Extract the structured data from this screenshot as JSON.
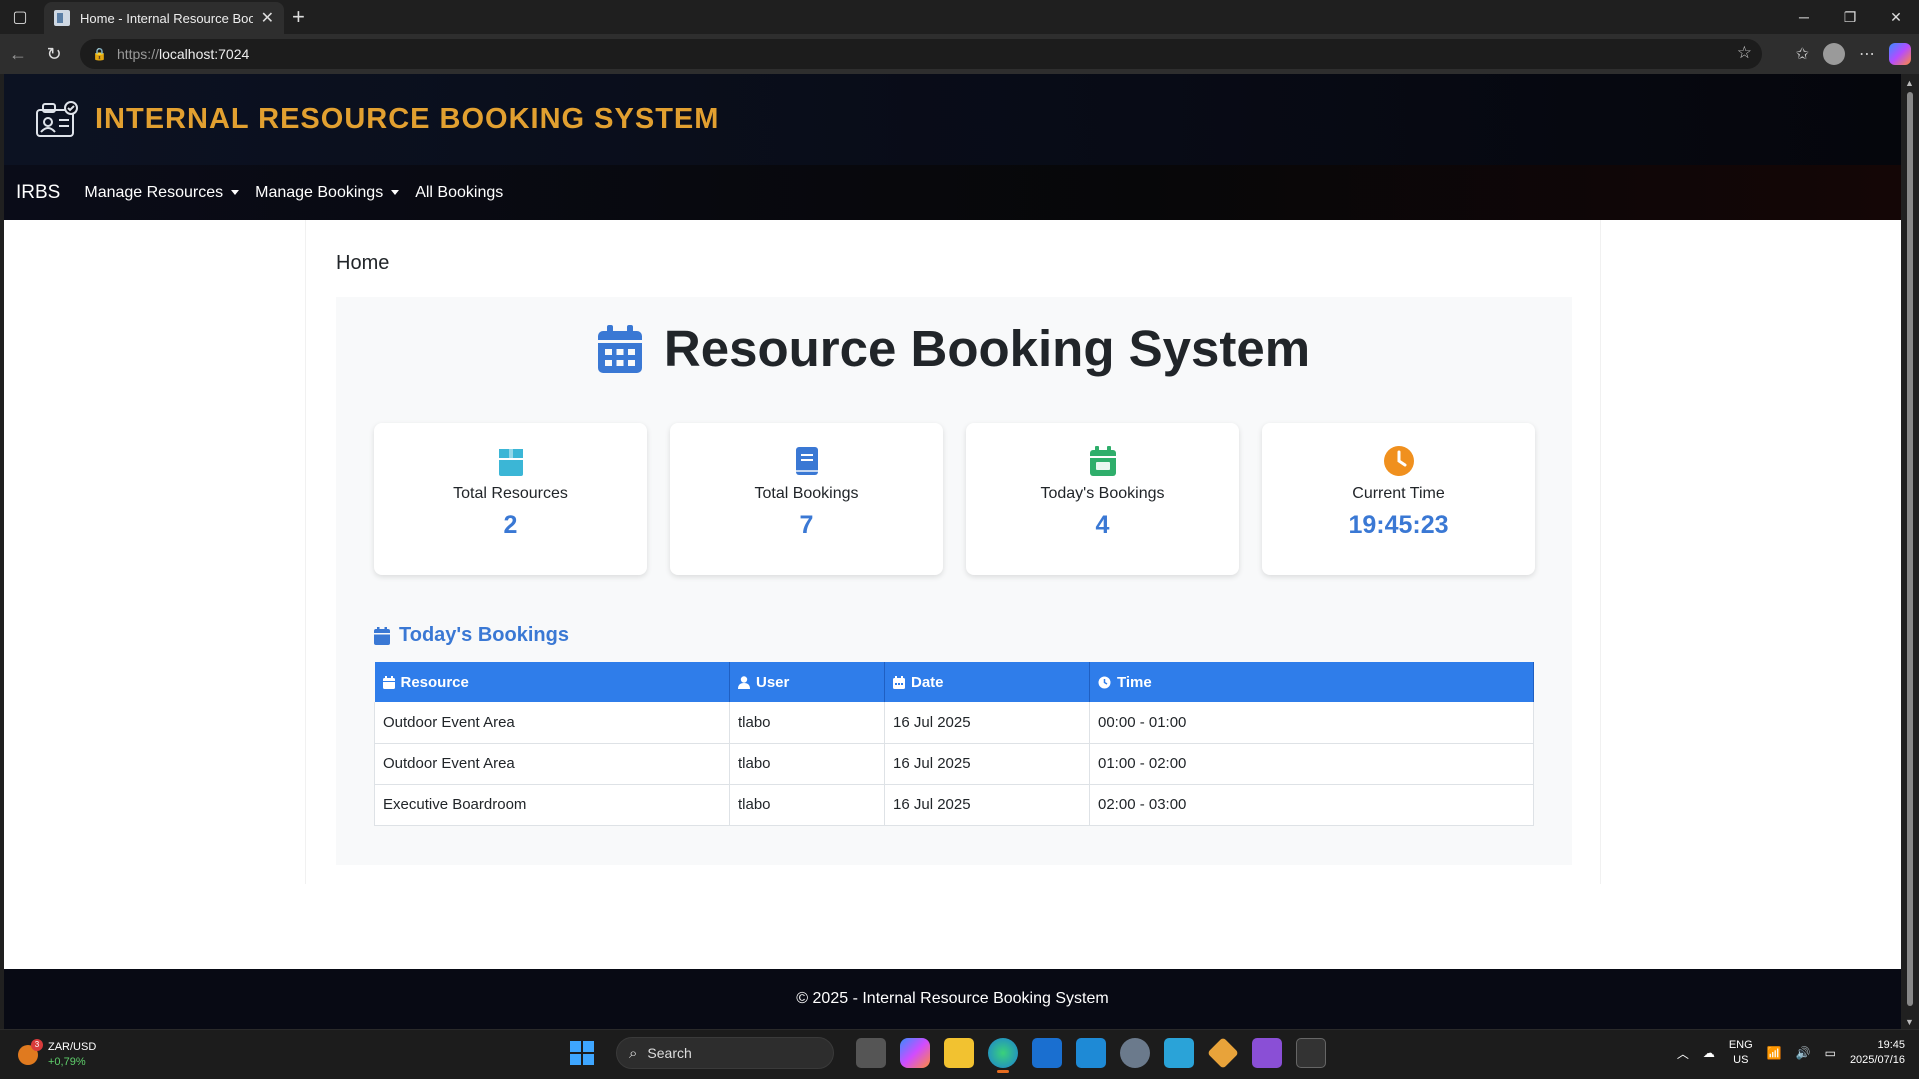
{
  "browser": {
    "tab_title": "Home - Internal Resource Booking System",
    "url_protocol": "https://",
    "url_host": "localhost:7024"
  },
  "site": {
    "header_title": "INTERNAL RESOURCE BOOKING SYSTEM",
    "brand": "IRBS",
    "nav": {
      "manage_resources": "Manage Resources",
      "manage_bookings": "Manage Bookings",
      "all_bookings": "All Bookings"
    },
    "footer": "© 2025 - Internal Resource Booking System"
  },
  "page": {
    "heading": "Home",
    "hero_title": "Resource Booking System",
    "cards": [
      {
        "label": "Total Resources",
        "value": "2",
        "icon": "box-icon",
        "color": "#3bb6d6"
      },
      {
        "label": "Total Bookings",
        "value": "7",
        "icon": "book-icon",
        "color": "#3a78d4"
      },
      {
        "label": "Today's Bookings",
        "value": "4",
        "icon": "calendar-check-icon",
        "color": "#2fae6b"
      },
      {
        "label": "Current Time",
        "value": "19:45:23",
        "icon": "clock-icon",
        "color": "#f0901e"
      }
    ],
    "section_title": "Today's Bookings",
    "table": {
      "headers": [
        "Resource",
        "User",
        "Date",
        "Time"
      ],
      "rows": [
        [
          "Outdoor Event Area",
          "tlabo",
          "16 Jul 2025",
          "00:00 - 01:00"
        ],
        [
          "Outdoor Event Area",
          "tlabo",
          "16 Jul 2025",
          "01:00 - 02:00"
        ],
        [
          "Executive Boardroom",
          "tlabo",
          "16 Jul 2025",
          "02:00 - 03:00"
        ]
      ]
    },
    "accent_color": "#3a78d4",
    "header_color": "#2f7dea"
  },
  "taskbar": {
    "ticker_pair": "ZAR/USD",
    "ticker_change": "+0,79%",
    "search_placeholder": "Search",
    "lang": "ENG",
    "region": "US",
    "time": "19:45",
    "date": "2025/07/16"
  }
}
